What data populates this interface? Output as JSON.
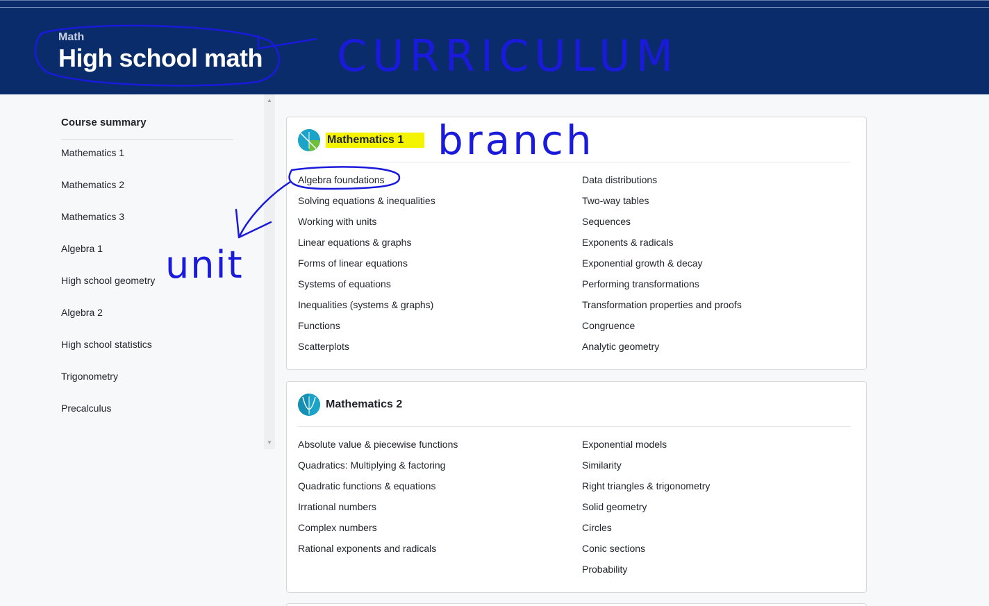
{
  "header": {
    "breadcrumb": "Math",
    "title": "High school math",
    "background_color": "#0b2c6b"
  },
  "sidebar": {
    "heading": "Course summary",
    "items": [
      "Mathematics 1",
      "Mathematics 2",
      "Mathematics 3",
      "Algebra 1",
      "High school geometry",
      "Algebra 2",
      "High school statistics",
      "Trigonometry",
      "Precalculus"
    ]
  },
  "courses": [
    {
      "title": "Mathematics 1",
      "icon": "math1-course-icon",
      "units_left": [
        "Algebra foundations",
        "Solving equations & inequalities",
        "Working with units",
        "Linear equations & graphs",
        "Forms of linear equations",
        "Systems of equations",
        "Inequalities (systems & graphs)",
        "Functions",
        "Scatterplots"
      ],
      "units_right": [
        "Data distributions",
        "Two-way tables",
        "Sequences",
        "Exponents & radicals",
        "Exponential growth & decay",
        "Performing transformations",
        "Transformation properties and proofs",
        "Congruence",
        "Analytic geometry"
      ]
    },
    {
      "title": "Mathematics 2",
      "icon": "math2-course-icon",
      "units_left": [
        "Absolute value & piecewise functions",
        "Quadratics: Multiplying & factoring",
        "Quadratic functions & equations",
        "Irrational numbers",
        "Complex numbers",
        "Rational exponents and radicals"
      ],
      "units_right": [
        "Exponential models",
        "Similarity",
        "Right triangles & trigonometry",
        "Solid geometry",
        "Circles",
        "Conic sections",
        "Probability"
      ]
    }
  ],
  "annotations": {
    "curriculum_note": "CURRICULUM",
    "branch_note": "branch",
    "unit_note": "unit",
    "ink_color": "#1a1adb",
    "highlight_color": "#f4f400"
  }
}
